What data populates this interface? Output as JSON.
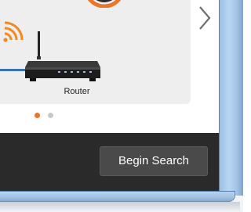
{
  "carousel": {
    "slide": {
      "device_label": "Router",
      "icons": [
        "wifi-signal-icon",
        "router-icon",
        "device-circle-icon"
      ]
    },
    "next_icon": "chevron-right-icon",
    "dots": [
      {
        "active": true,
        "color": "#e8762b"
      },
      {
        "active": false,
        "color": "#c8c8c8"
      }
    ]
  },
  "footer": {
    "begin_label": "Begin Search"
  },
  "colors": {
    "accent": "#e8762b",
    "footer_bg": "#2a2a2a",
    "button_bg": "#4a4a4a",
    "card_bg": "#eeeeee",
    "cable": "#3e6fb5"
  }
}
